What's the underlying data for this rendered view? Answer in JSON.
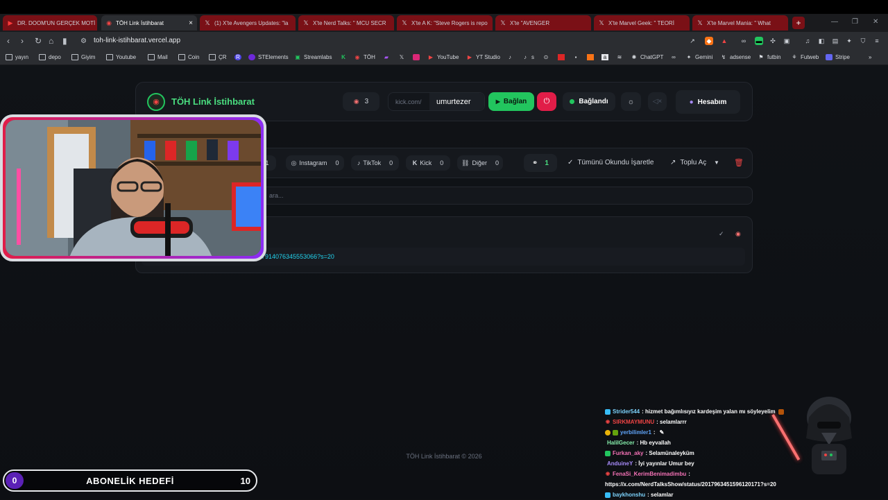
{
  "browser": {
    "tabs": [
      {
        "title": "DR. DOOM'UN GERÇEK MOTİ",
        "icon": "youtube-icon"
      },
      {
        "title": "TÖH Link İstihbarat",
        "icon": "toh-icon",
        "close": "×"
      },
      {
        "title": "(1) X'te Avengers Updates: \"la",
        "icon": "x-icon"
      },
      {
        "title": "X'te Nerd Talks: \" MCU SECR",
        "icon": "x-icon"
      },
      {
        "title": "X'te A K: \"Steve Rogers is repo",
        "icon": "x-icon"
      },
      {
        "title": "X'te \"AVENGER",
        "icon": "x-icon"
      },
      {
        "title": "X'te Marvel Geek: \" TEORİ",
        "icon": "x-icon"
      },
      {
        "title": "X'te Marvel Mania: \" What",
        "icon": "x-icon"
      }
    ],
    "new_tab": "+",
    "url": "toh-link-istihbarat.vercel.app",
    "bookmarks": [
      "yayın",
      "depo",
      "Giyim",
      "Youtube",
      "Mail",
      "Coin",
      "ÇR",
      "STElements",
      "Streamlabs",
      "TÖH",
      "YouTube",
      "YT Studio",
      "s",
      "ChatGPT",
      "Gemini",
      "adsense",
      "futbin",
      "Futweb",
      "Stripe"
    ],
    "more": "»"
  },
  "header": {
    "title": "TÖH Link İstihbarat",
    "badge_count": "3",
    "kick_prefix": "kick.com/",
    "channel": "umurtezer",
    "connect_label": "Bağlan",
    "status_label": "Bağlandı",
    "account_label": "Hesabım"
  },
  "filters": {
    "items": [
      {
        "label": "",
        "count": "1"
      },
      {
        "label": "Instagram",
        "count": "0"
      },
      {
        "label": "TikTok",
        "count": "0"
      },
      {
        "label": "Kick",
        "count": "0"
      },
      {
        "label": "Diğer",
        "count": "0"
      }
    ],
    "link_count": "1",
    "mark_all_read": "Tümünü Okundu İşaretle",
    "bulk_open": "Toplu Aç"
  },
  "search": {
    "placeholder": "ara..."
  },
  "link_item": {
    "url_tail": "17914076345553066?s=20"
  },
  "footer": {
    "text": "TÖH Link İstihbarat © 2026"
  },
  "goal": {
    "current": "0",
    "title": "ABONELİK HEDEFİ",
    "target": "10"
  },
  "chat": [
    {
      "user": "Strider544",
      "text": ": hizmet bağımlısıyız kardeşim yalan mı söyleyelim",
      "color": "#7dd3fc"
    },
    {
      "user": "SIRKMAYMUNU",
      "text": ": selamlarrr",
      "color": "#ef4444"
    },
    {
      "user": "yerbilimler1",
      "text": ":",
      "color": "#60a5fa"
    },
    {
      "user": "HalilGecer",
      "text": ": Hb eyvallah",
      "color": "#86efac"
    },
    {
      "user": "Furkan_aky",
      "text": ": Selamünaleyküm",
      "color": "#f472b6"
    },
    {
      "user": "AnduineY",
      "text": ": İyi yayınlar Umur bey",
      "color": "#a78bfa"
    },
    {
      "user": "FenaSi_KerimBenimadimbu",
      "text": ":",
      "color": "#f472b6"
    },
    {
      "user": "",
      "text": "https://x.com/NerdTalksShow/status/2017963451596120171?s=20",
      "color": "#ffffff"
    },
    {
      "user": "baykhonshu",
      "text": ": selamlar",
      "color": "#7dd3fc"
    }
  ]
}
